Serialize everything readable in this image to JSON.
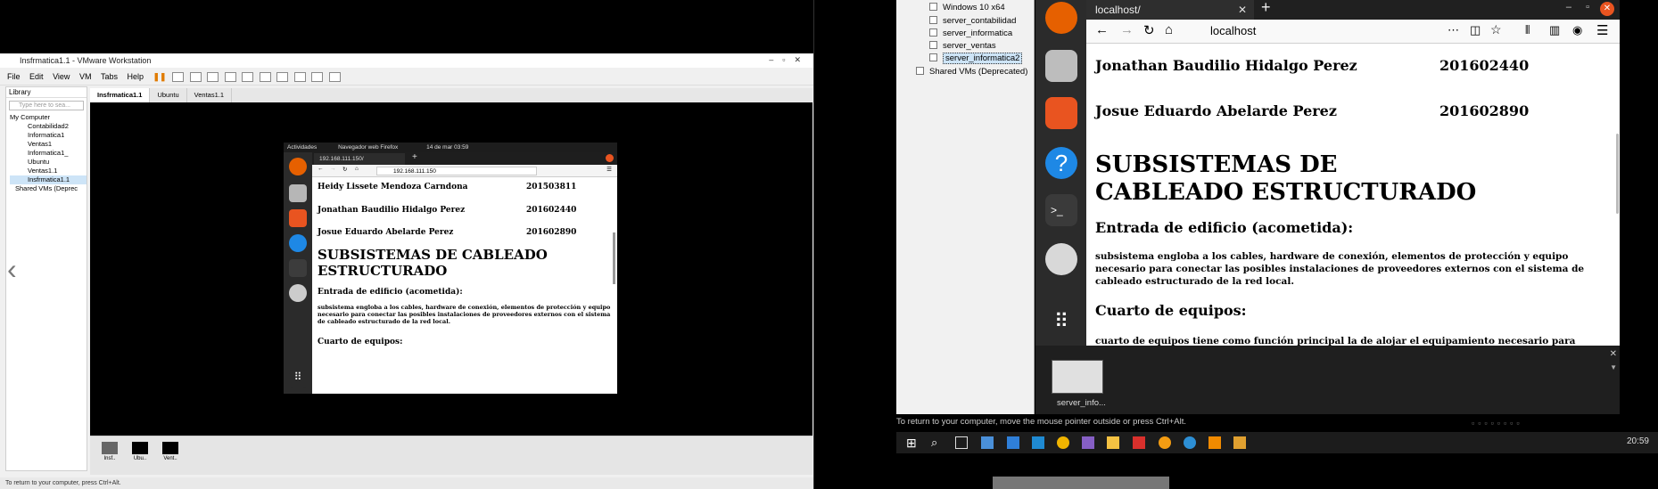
{
  "vmware": {
    "title": "Insfrmatica1.1 - VMware Workstation",
    "menu": [
      "File",
      "Edit",
      "View",
      "VM",
      "Tabs",
      "Help"
    ],
    "library": {
      "label": "Library",
      "search_placeholder": "Type here to sea...",
      "tree": [
        "My Computer",
        "Contabilidad2",
        "Informatica1",
        "Ventas1",
        "Informatica1_",
        "Ubuntu",
        "Ventas1.1",
        "Insfrmatica1.1",
        "Shared VMs (Deprec"
      ]
    },
    "tabs": [
      "Insfrmatica1.1",
      "Ubuntu",
      "Ventas1.1"
    ],
    "thumbs": [
      "Insf..",
      "Ubu..",
      "Vent.."
    ],
    "status": "To return to your computer, press Ctrl+Alt."
  },
  "guest": {
    "topbar": {
      "activities": "Actividades",
      "app": "Navegador web Firefox",
      "date": "14 de mar 03:59"
    },
    "tab_title": "192.168.111.150/",
    "url": "192.168.111.150",
    "rows": [
      {
        "name": "Heidy Lissete Mendoza Carndona",
        "id": "201503811"
      },
      {
        "name": "Jonathan Baudilio Hidalgo Perez",
        "id": "201602440"
      },
      {
        "name": "Josue Eduardo Abelarde Perez",
        "id": "201602890"
      }
    ],
    "heading": "SUBSISTEMAS DE CABLEADO ESTRUCTURADO",
    "sub1": "Entrada de edificio (acometida):",
    "para1": "subsistema engloba a los cables, hardware de conexión, elementos de protección y equipo necesario para conectar las posibles instalaciones de proveedores externos con el sistema de cableado estructurado de la red local.",
    "sub2": "Cuarto de equipos:"
  },
  "hyperv": {
    "items": [
      "Windows 10 x64",
      "server_contabilidad",
      "server_informatica",
      "server_ventas",
      "server_informatica2"
    ],
    "shared": "Shared VMs (Deprecated)",
    "selected": "server_informatica2"
  },
  "right": {
    "tab_title": "localhost/",
    "url": "localhost",
    "rows": [
      {
        "name": "Jonathan Baudilio Hidalgo Perez",
        "id": "201602440"
      },
      {
        "name": "Josue Eduardo Abelarde Perez",
        "id": "201602890"
      }
    ],
    "heading": "SUBSISTEMAS DE CABLEADO ESTRUCTURADO",
    "sub1": "Entrada de edificio (acometida):",
    "para1": "subsistema engloba a los cables, hardware de conexión, elementos de protección y equipo necesario para conectar las posibles instalaciones de proveedores externos con el sistema de cableado estructurado de la red local.",
    "sub2": "Cuarto de equipos:",
    "para2": "cuarto de equipos tiene como función principal la de alojar el equipamiento necesario para",
    "thumb_label": "server_info...",
    "hint": "To return to your computer, move the mouse pointer outside or press Ctrl+Alt.",
    "clock": "20:59"
  }
}
